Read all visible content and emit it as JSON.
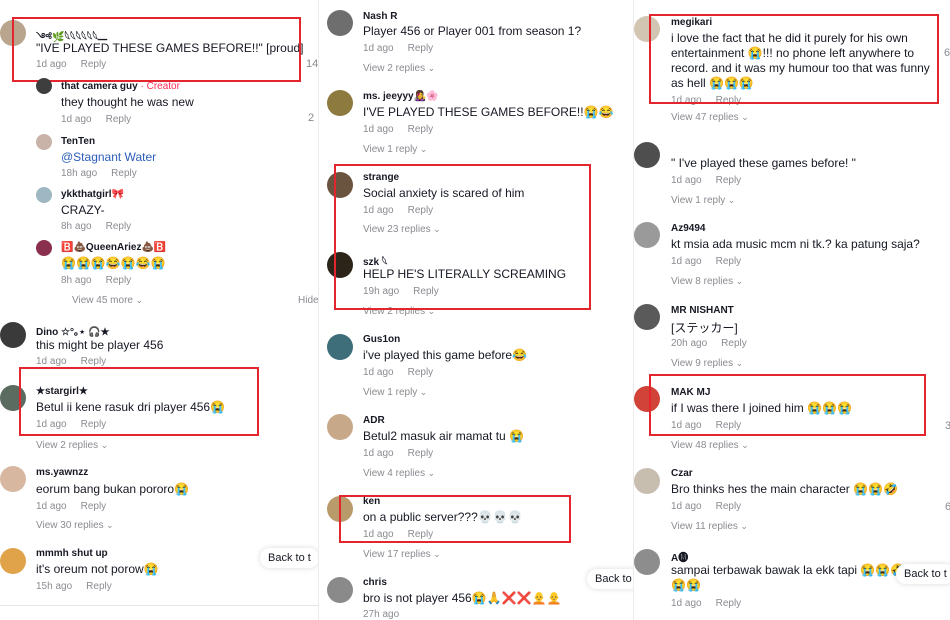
{
  "reply_label": "Reply",
  "panel1": {
    "c1": {
      "user": "༺🌿𓆩𓆩𓆩𓆩𓆩𓆩ـــ",
      "text": "\"IVE PLAYED THESE GAMES BEFORE!!\" [proud]",
      "time": "1d ago",
      "count": "14"
    },
    "c2": {
      "user": "that camera guy",
      "badge": "· Creator",
      "text": "they thought he was new",
      "time": "1d ago",
      "count": "2"
    },
    "c3": {
      "user": "TenTen",
      "text": "@Stagnant Water",
      "time": "18h ago"
    },
    "c4": {
      "user": "ykkthatgirl🎀",
      "text": "CRAZY-",
      "time": "8h ago"
    },
    "c5": {
      "user": "🅱️💩QueenAriez💩🅱️",
      "text": "😭😭😭😂😭😂😭",
      "time": "8h ago"
    },
    "view_more": "View 45 more",
    "hide": "Hide",
    "c6": {
      "user": "Dino ☆°｡⋆ 🎧★",
      "text": "this might be player 456",
      "time": "1d ago"
    },
    "c7": {
      "user": "★stargirl★",
      "text": "Betul ii kene rasuk dri player 456😭",
      "time": "1d ago",
      "replies": "View 2 replies"
    },
    "c8": {
      "user": "ms.yawnzz",
      "text": "eorum bang bukan pororo😭",
      "time": "1d ago",
      "replies": "View 30 replies"
    },
    "c9": {
      "user": "mmmh shut up",
      "text": "it's oreum not porow😭",
      "time": "15h ago"
    },
    "back_to_top": "Back to t"
  },
  "panel2": {
    "c1": {
      "user": "Nash R",
      "text": "Player 456 or Player 001 from season 1?",
      "time": "1d ago",
      "replies": "View 2 replies"
    },
    "c2": {
      "user": "ms. jeeyyy👩‍🎤🌸",
      "text": "I'VE PLAYED THESE GAMES BEFORE!!😭😂",
      "time": "1d ago",
      "replies": "View 1 reply"
    },
    "c3": {
      "user": "strange",
      "text": "Social anxiety is scared of him",
      "time": "1d ago",
      "replies": "View 23 replies"
    },
    "c4": {
      "user": "szk 𓆩",
      "text": "HELP HE'S LITERALLY SCREAMING",
      "time": "19h ago",
      "replies": "View 2 replies"
    },
    "c5": {
      "user": "Gus1on",
      "text": "i've played this game before😂",
      "time": "1d ago",
      "replies": "View 1 reply"
    },
    "c6": {
      "user": "ADR",
      "text": "Betul2 masuk air mamat tu 😭",
      "time": "1d ago",
      "replies": "View 4 replies"
    },
    "c7": {
      "user": "ken",
      "text": "on a public server???💀💀💀",
      "time": "1d ago",
      "replies": "View 17 replies"
    },
    "c8": {
      "user": "chris",
      "text": "bro is not player 456😭🙏❌❌🧑‍🦲🧑‍🦲",
      "time": "27h ago"
    },
    "back_to_top": "Back to"
  },
  "panel3": {
    "c1": {
      "user": "megikari",
      "text1": "i love the fact that he did it purely for his own",
      "text2": "entertainment 😭!!! no phone left anywhere to",
      "text3": "record. and it was my humour too that was funny",
      "text4": "as hell 😭😭😭",
      "time": "1d ago",
      "replies": "View 47 replies",
      "count": "6"
    },
    "c2": {
      "user": "",
      "text": "\" I've played these games before! \"",
      "time": "1d ago",
      "replies": "View 1 reply"
    },
    "c3": {
      "user": "Az9494",
      "text": "kt msia ada music mcm ni tk.? ka patung saja?",
      "time": "1d ago",
      "replies": "View 8 replies"
    },
    "c4": {
      "user": "MR NISHANT",
      "text": "[ステッカー]",
      "time": "20h ago",
      "replies": "View 9 replies"
    },
    "c5": {
      "user": "MAK MJ",
      "text": "if I was there I joined him 😭😭😭",
      "time": "1d ago",
      "replies": "View 48 replies",
      "count": "3"
    },
    "c6": {
      "user": "Czar",
      "text": "Bro thinks hes the main character 😭😭🤣",
      "time": "1d ago",
      "replies": "View 11 replies",
      "count": "6"
    },
    "c7": {
      "user": "A🅜",
      "text": "sampai terbawak bawak la ekk tapi 😭😭🤣",
      "text2": "😭😭",
      "time": "1d ago"
    },
    "back_to_top": "Back to t"
  }
}
